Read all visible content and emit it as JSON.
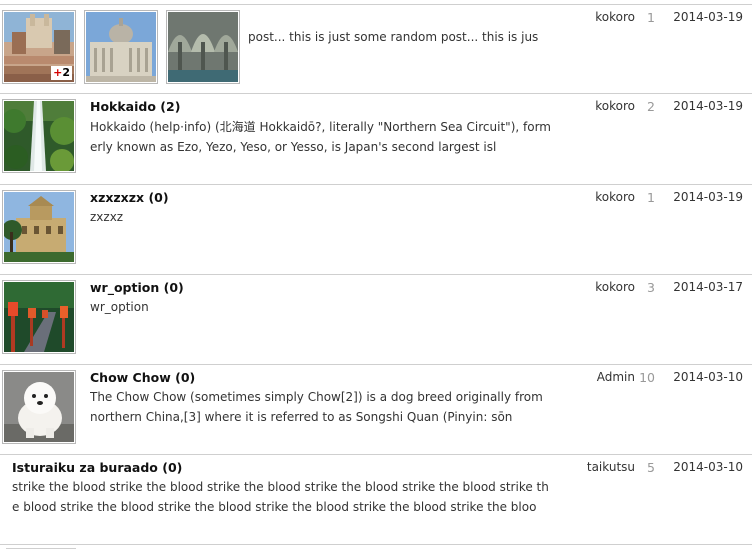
{
  "posts": [
    {
      "title": "",
      "count": "",
      "excerpt": "post... this is just some random post... this is jus",
      "author": "kokoro",
      "replies": "1",
      "date": "2014-03-19",
      "extra_images": "2",
      "thumbs": [
        "spanish-steps-rome",
        "st-peters-basilica",
        "mosque-interior"
      ]
    },
    {
      "title": "Hokkaido",
      "count": "(2)",
      "excerpt": "Hokkaido (help·info) (北海道 Hokkaidō?, literally \"Northern Sea Circuit\"), formerly known as Ezo, Yezo, Yeso, or Yesso, is Japan's second largest isl",
      "author": "kokoro",
      "replies": "2",
      "date": "2014-03-19",
      "thumbs": [
        "waterfall-forest"
      ]
    },
    {
      "title": "xzxzxzx",
      "count": "(0)",
      "excerpt": "zxzxz",
      "author": "kokoro",
      "replies": "1",
      "date": "2014-03-19",
      "thumbs": [
        "palace-palm-trees"
      ]
    },
    {
      "title": "wr_option",
      "count": "(0)",
      "excerpt": "wr_option",
      "author": "kokoro",
      "replies": "3",
      "date": "2014-03-17",
      "thumbs": [
        "lantern-path"
      ]
    },
    {
      "title": "Chow Chow",
      "count": "(0)",
      "excerpt": "The Chow Chow (sometimes simply Chow[2]) is a dog breed originally from northern China,[3]  where it is referred to as Songshi Quan (Pinyin: sōn",
      "author": "Admin",
      "replies": "10",
      "date": "2014-03-10",
      "thumbs": [
        "white-chow-chow-dog"
      ]
    },
    {
      "title": "Isturaiku za buraado",
      "count": "(0)",
      "excerpt": "strike the blood strike the blood strike the blood strike the blood strike the blood strike the blood strike the blood strike the blood strike the blood strike the blood strike the bloo",
      "author": "taikutsu",
      "replies": "5",
      "date": "2014-03-10",
      "thumbs": []
    }
  ]
}
